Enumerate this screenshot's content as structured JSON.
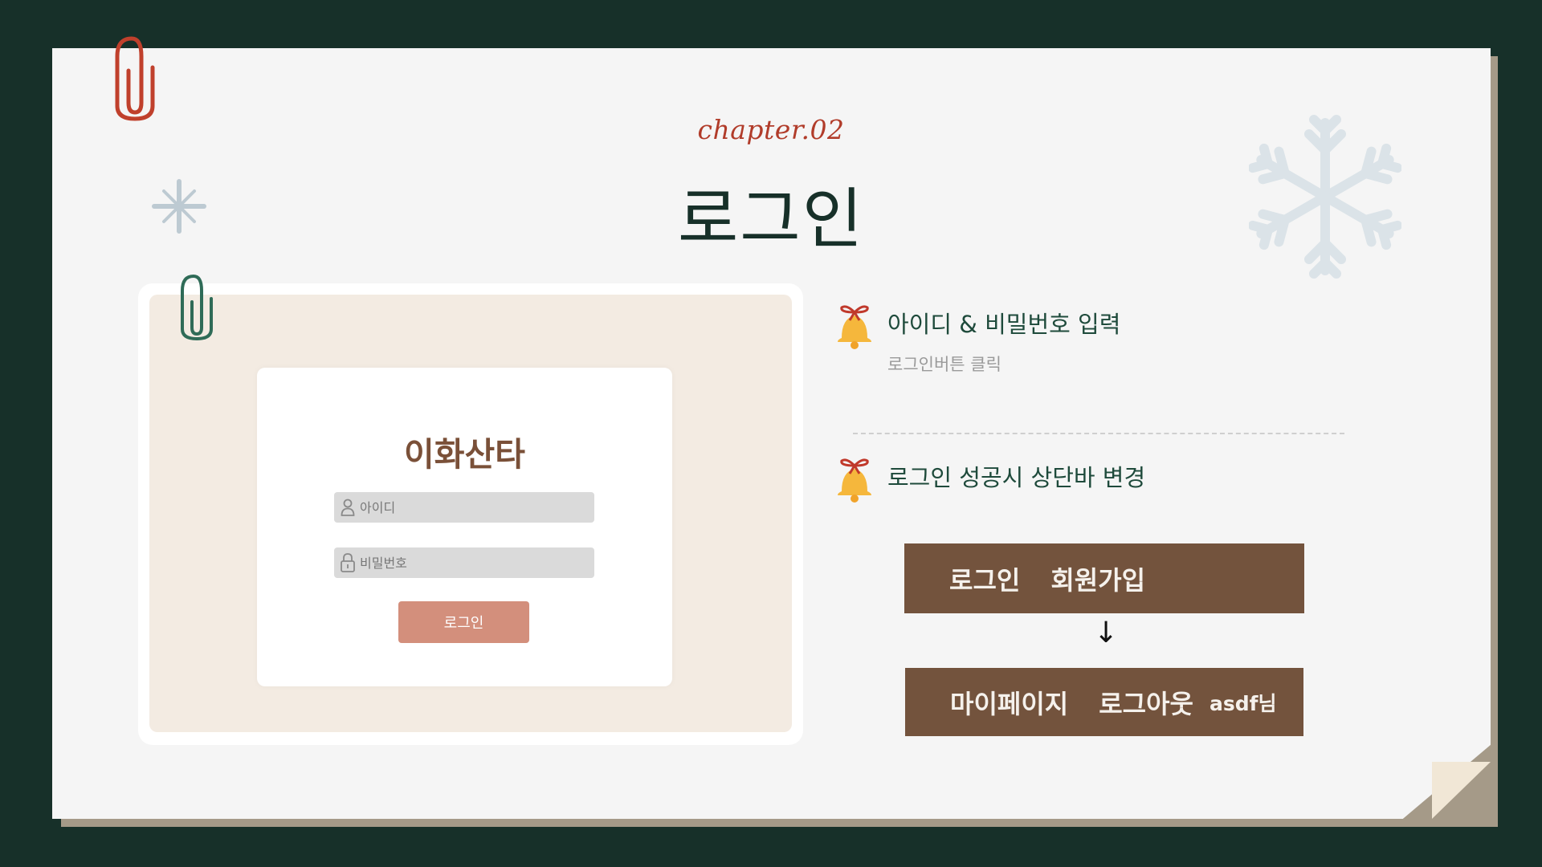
{
  "slide": {
    "chapter": "chapter.02",
    "title": "로그인"
  },
  "login_card": {
    "brand": "이화산타",
    "id_placeholder": "아이디",
    "pw_placeholder": "비밀번호",
    "button_label": "로그인"
  },
  "steps": [
    {
      "title": "아이디 & 비밀번호 입력",
      "subtitle": "로그인버튼 클릭"
    },
    {
      "title": "로그인 성공시 상단바 변경"
    }
  ],
  "navbar_before": {
    "login": "로그인",
    "signup": "회원가입"
  },
  "arrow": "↓",
  "navbar_after": {
    "mypage": "마이페이지",
    "logout": "로그아웃",
    "user": "asdf님"
  },
  "colors": {
    "background": "#173029",
    "paper": "#f5f5f5",
    "accent_red": "#b13c2a",
    "green_text": "#1e4a3b",
    "navbar_brown": "#73533d",
    "login_button": "#d38f7c"
  },
  "icons": [
    "paperclip-icon",
    "snowflake-icon",
    "bell-icon",
    "user-icon",
    "lock-icon"
  ]
}
